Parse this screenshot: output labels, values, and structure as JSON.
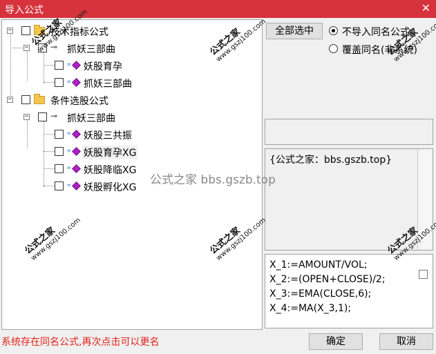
{
  "window": {
    "title": "导入公式",
    "close_glyph": "✕"
  },
  "tree": {
    "groups": [
      {
        "label": "技术指标公式",
        "sub": {
          "label": "抓妖三部曲",
          "items": [
            "妖股育孕",
            "抓妖三部曲"
          ]
        }
      },
      {
        "label": "条件选股公式",
        "sub": {
          "label": "抓妖三部曲",
          "items": [
            "妖股三共振",
            "妖股育孕XG",
            "妖股降临XG",
            "妖股孵化XG"
          ]
        }
      }
    ],
    "expander_glyph": "−"
  },
  "options": {
    "select_all_label": "全部选中",
    "radio_skip_label": "不导入同名公式",
    "radio_overwrite_label": "覆盖同名(非系统)",
    "selected_radio": "radio_skip_label"
  },
  "description": "{公式之家：bbs.gszb.top}",
  "code_lines": [
    "X_1:=AMOUNT/VOL;",
    "X_2:=(OPEN+CLOSE)/2;",
    "X_3:=EMA(CLOSE,6);",
    "X_4:=MA(X_3,1);"
  ],
  "watermark": {
    "title": "公式之家",
    "url": "www.gszj100.com",
    "center": "公式之家 bbs.gszb.top"
  },
  "status_text": "系统存在同名公式,再次点击可以更名",
  "buttons": {
    "ok": "确定",
    "cancel": "取消"
  },
  "colors": {
    "titlebar": "#d6333d",
    "status": "#e0231a",
    "formula_icon": "#b21ec8"
  }
}
